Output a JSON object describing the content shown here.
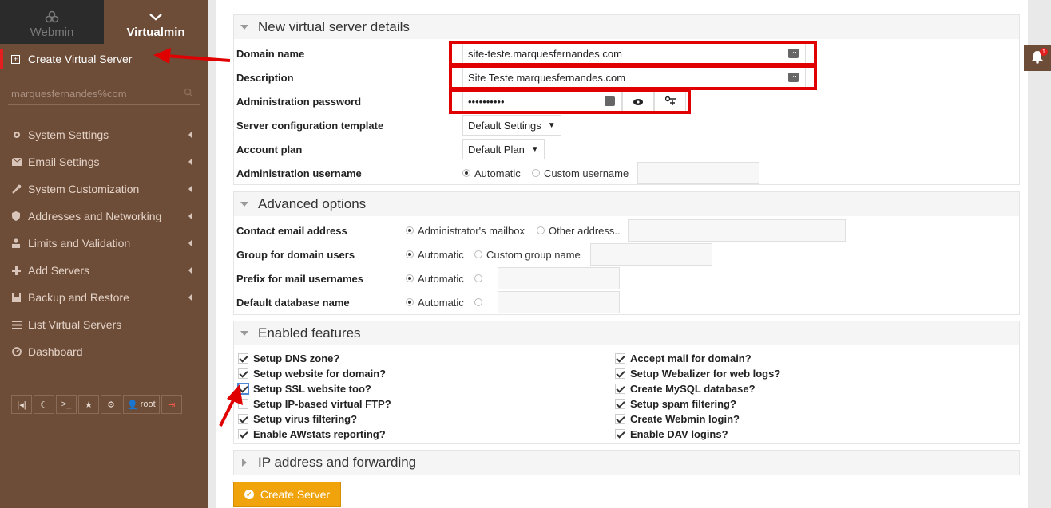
{
  "sidebar": {
    "switch": {
      "webmin": "Webmin",
      "virtualmin": "Virtualmin"
    },
    "active_item": "Create Virtual Server",
    "domain_selector": "marquesfernandes%com",
    "menu": [
      {
        "label": "System Settings",
        "icon": "gear-icon",
        "caret": true
      },
      {
        "label": "Email Settings",
        "icon": "envelope-icon",
        "caret": true
      },
      {
        "label": "System Customization",
        "icon": "wrench-icon",
        "caret": true
      },
      {
        "label": "Addresses and Networking",
        "icon": "shield-icon",
        "caret": true
      },
      {
        "label": "Limits and Validation",
        "icon": "user-lock-icon",
        "caret": true
      },
      {
        "label": "Add Servers",
        "icon": "plus-icon",
        "caret": true
      },
      {
        "label": "Backup and Restore",
        "icon": "save-icon",
        "caret": true
      },
      {
        "label": "List Virtual Servers",
        "icon": "list-icon",
        "caret": false
      },
      {
        "label": "Dashboard",
        "icon": "dashboard-icon",
        "caret": false
      }
    ],
    "tools": {
      "user": "root"
    }
  },
  "details": {
    "title": "New virtual server details",
    "domain_label": "Domain name",
    "domain_value": "site-teste.marquesfernandes.com",
    "description_label": "Description",
    "description_value": "Site Teste marquesfernandes.com",
    "password_label": "Administration password",
    "password_value": "••••••••••",
    "template_label": "Server configuration template",
    "template_value": "Default Settings",
    "plan_label": "Account plan",
    "plan_value": "Default Plan",
    "username_label": "Administration username",
    "username_auto": "Automatic",
    "username_custom": "Custom username"
  },
  "advanced": {
    "title": "Advanced options",
    "contact_label": "Contact email address",
    "contact_opt1": "Administrator's mailbox",
    "contact_opt2": "Other address..",
    "group_label": "Group for domain users",
    "group_opt1": "Automatic",
    "group_opt2": "Custom group name",
    "prefix_label": "Prefix for mail usernames",
    "prefix_opt1": "Automatic",
    "db_label": "Default database name",
    "db_opt1": "Automatic"
  },
  "features": {
    "title": "Enabled features",
    "left": [
      {
        "label": "Setup DNS zone?",
        "checked": true
      },
      {
        "label": "Setup website for domain?",
        "checked": true
      },
      {
        "label": "Setup SSL website too?",
        "checked": true
      },
      {
        "label": "Setup IP-based virtual FTP?",
        "checked": false
      },
      {
        "label": "Setup virus filtering?",
        "checked": true
      },
      {
        "label": "Enable AWstats reporting?",
        "checked": true
      }
    ],
    "right": [
      {
        "label": "Accept mail for domain?",
        "checked": true
      },
      {
        "label": "Setup Webalizer for web logs?",
        "checked": true
      },
      {
        "label": "Create MySQL database?",
        "checked": true
      },
      {
        "label": "Setup spam filtering?",
        "checked": true
      },
      {
        "label": "Create Webmin login?",
        "checked": true
      },
      {
        "label": "Enable DAV logins?",
        "checked": true
      }
    ]
  },
  "ip_section": {
    "title": "IP address and forwarding"
  },
  "actions": {
    "create": "Create Server"
  },
  "notifications": {
    "count": "1"
  },
  "colors": {
    "sidebar": "#6d4c38",
    "accent_button": "#f0a30a",
    "highlight_red": "#e00000"
  }
}
